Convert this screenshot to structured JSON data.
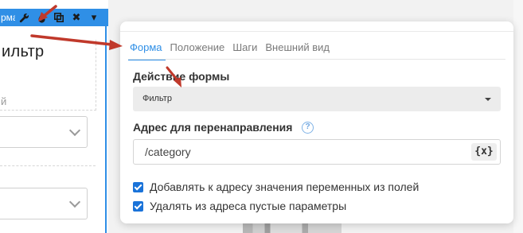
{
  "toolbar": {
    "label": "рма",
    "buttons": [
      {
        "icon": "wrench-icon"
      },
      {
        "icon": "drop-icon"
      },
      {
        "icon": "copy-icon"
      },
      {
        "icon": "close-icon",
        "glyph": "✖"
      },
      {
        "icon": "chevron-down-icon",
        "glyph": "▾"
      }
    ]
  },
  "form_block": {
    "title": "ильтр",
    "hint": "й"
  },
  "popup": {
    "tabs": [
      {
        "label": "Форма",
        "active": true
      },
      {
        "label": "Положение",
        "active": false
      },
      {
        "label": "Шаги",
        "active": false
      },
      {
        "label": "Внешний вид",
        "active": false
      }
    ],
    "action": {
      "label": "Действие формы",
      "value": "Фильтр"
    },
    "redirect": {
      "label": "Адрес для перенаправления",
      "help": "?",
      "value": "/category",
      "var_button": "{x}"
    },
    "checkboxes": [
      {
        "label": "Добавлять к адресу значения переменных из полей",
        "checked": true
      },
      {
        "label": "Удалять из адреса пустые параметры",
        "checked": true
      }
    ]
  },
  "colors": {
    "accent": "#2f8fe6",
    "arrow": "#c0392b",
    "checkbox": "#1a73d9"
  }
}
